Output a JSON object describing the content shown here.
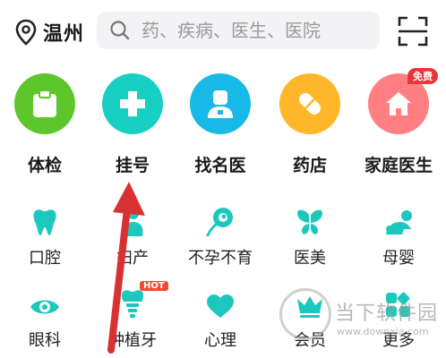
{
  "header": {
    "city": "温州",
    "search_placeholder": "药、疾病、医生、医院"
  },
  "top_services": [
    {
      "label": "体检",
      "icon": "clipboard-icon",
      "color": "#5cc62b"
    },
    {
      "label": "挂号",
      "icon": "cross-icon",
      "color": "#18cfc4"
    },
    {
      "label": "找名医",
      "icon": "doctor-icon",
      "color": "#18b9e6"
    },
    {
      "label": "药店",
      "icon": "pill-icon",
      "color": "#ffb629"
    },
    {
      "label": "家庭医生",
      "icon": "house-icon",
      "color": "#ff7f82",
      "badge": "免费"
    }
  ],
  "grid": [
    {
      "label": "口腔",
      "icon": "tooth-icon"
    },
    {
      "label": "妇产",
      "icon": "maternity-icon"
    },
    {
      "label": "不孕不育",
      "icon": "fertility-icon"
    },
    {
      "label": "医美",
      "icon": "butterfly-icon"
    },
    {
      "label": "母婴",
      "icon": "baby-icon"
    },
    {
      "label": "眼科",
      "icon": "eye-icon"
    },
    {
      "label": "种植牙",
      "icon": "implant-icon",
      "badge": "HOT"
    },
    {
      "label": "心理",
      "icon": "heart-icon"
    },
    {
      "label": "会员",
      "icon": "crown-icon"
    },
    {
      "label": "更多",
      "icon": "more-icon"
    }
  ],
  "accent_color": "#1cc8bd",
  "watermark": {
    "text": "当下软件园",
    "url": "www.downxia.com"
  }
}
